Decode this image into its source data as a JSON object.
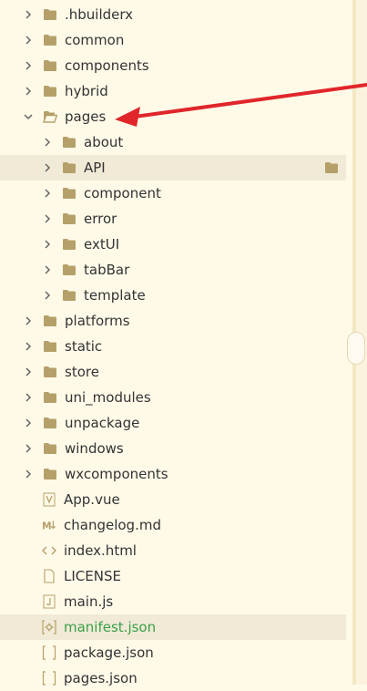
{
  "tree": [
    {
      "name": "hbuilderx-folder",
      "label": ".hbuilderx",
      "indent": 0,
      "type": "folder",
      "expanded": false
    },
    {
      "name": "common-folder",
      "label": "common",
      "indent": 0,
      "type": "folder",
      "expanded": false
    },
    {
      "name": "components-folder",
      "label": "components",
      "indent": 0,
      "type": "folder",
      "expanded": false
    },
    {
      "name": "hybrid-folder",
      "label": "hybrid",
      "indent": 0,
      "type": "folder",
      "expanded": false
    },
    {
      "name": "pages-folder",
      "label": "pages",
      "indent": 0,
      "type": "folder",
      "expanded": true
    },
    {
      "name": "about-folder",
      "label": "about",
      "indent": 1,
      "type": "folder",
      "expanded": false
    },
    {
      "name": "api-folder",
      "label": "API",
      "indent": 1,
      "type": "folder",
      "expanded": false,
      "selected": true,
      "trailing_icon": "folder-icon"
    },
    {
      "name": "component-folder",
      "label": "component",
      "indent": 1,
      "type": "folder",
      "expanded": false
    },
    {
      "name": "error-folder",
      "label": "error",
      "indent": 1,
      "type": "folder",
      "expanded": false
    },
    {
      "name": "extui-folder",
      "label": "extUI",
      "indent": 1,
      "type": "folder",
      "expanded": false
    },
    {
      "name": "tabbar-folder",
      "label": "tabBar",
      "indent": 1,
      "type": "folder",
      "expanded": false
    },
    {
      "name": "template-folder",
      "label": "template",
      "indent": 1,
      "type": "folder",
      "expanded": false
    },
    {
      "name": "platforms-folder",
      "label": "platforms",
      "indent": 0,
      "type": "folder",
      "expanded": false
    },
    {
      "name": "static-folder",
      "label": "static",
      "indent": 0,
      "type": "folder",
      "expanded": false
    },
    {
      "name": "store-folder",
      "label": "store",
      "indent": 0,
      "type": "folder",
      "expanded": false
    },
    {
      "name": "uni-modules-folder",
      "label": "uni_modules",
      "indent": 0,
      "type": "folder",
      "expanded": false
    },
    {
      "name": "unpackage-folder",
      "label": "unpackage",
      "indent": 0,
      "type": "folder",
      "expanded": false
    },
    {
      "name": "windows-folder",
      "label": "windows",
      "indent": 0,
      "type": "folder",
      "expanded": false
    },
    {
      "name": "wxcomponents-folder",
      "label": "wxcomponents",
      "indent": 0,
      "type": "folder",
      "expanded": false
    },
    {
      "name": "app-vue-file",
      "label": "App.vue",
      "indent": 0,
      "type": "file",
      "icon": "vue-file-icon"
    },
    {
      "name": "changelog-file",
      "label": "changelog.md",
      "indent": 0,
      "type": "file",
      "icon": "markdown-file-icon"
    },
    {
      "name": "index-html-file",
      "label": "index.html",
      "indent": 0,
      "type": "file",
      "icon": "html-file-icon"
    },
    {
      "name": "license-file",
      "label": "LICENSE",
      "indent": 0,
      "type": "file",
      "icon": "plain-file-icon"
    },
    {
      "name": "main-js-file",
      "label": "main.js",
      "indent": 0,
      "type": "file",
      "icon": "js-file-icon"
    },
    {
      "name": "manifest-file",
      "label": "manifest.json",
      "indent": 0,
      "type": "file",
      "icon": "manifest-file-icon",
      "highlight": true,
      "color": "#3aa14a"
    },
    {
      "name": "package-json-file",
      "label": "package.json",
      "indent": 0,
      "type": "file",
      "icon": "json-file-icon"
    },
    {
      "name": "pages-json-file",
      "label": "pages.json",
      "indent": 0,
      "type": "file",
      "icon": "json-file-icon"
    }
  ],
  "colors": {
    "background": "#fffae8",
    "folder": "#b6a06a",
    "selection": "#f1ead6",
    "arrow": "#e0262b",
    "text": "#333333",
    "manifest_text": "#3aa14a"
  }
}
